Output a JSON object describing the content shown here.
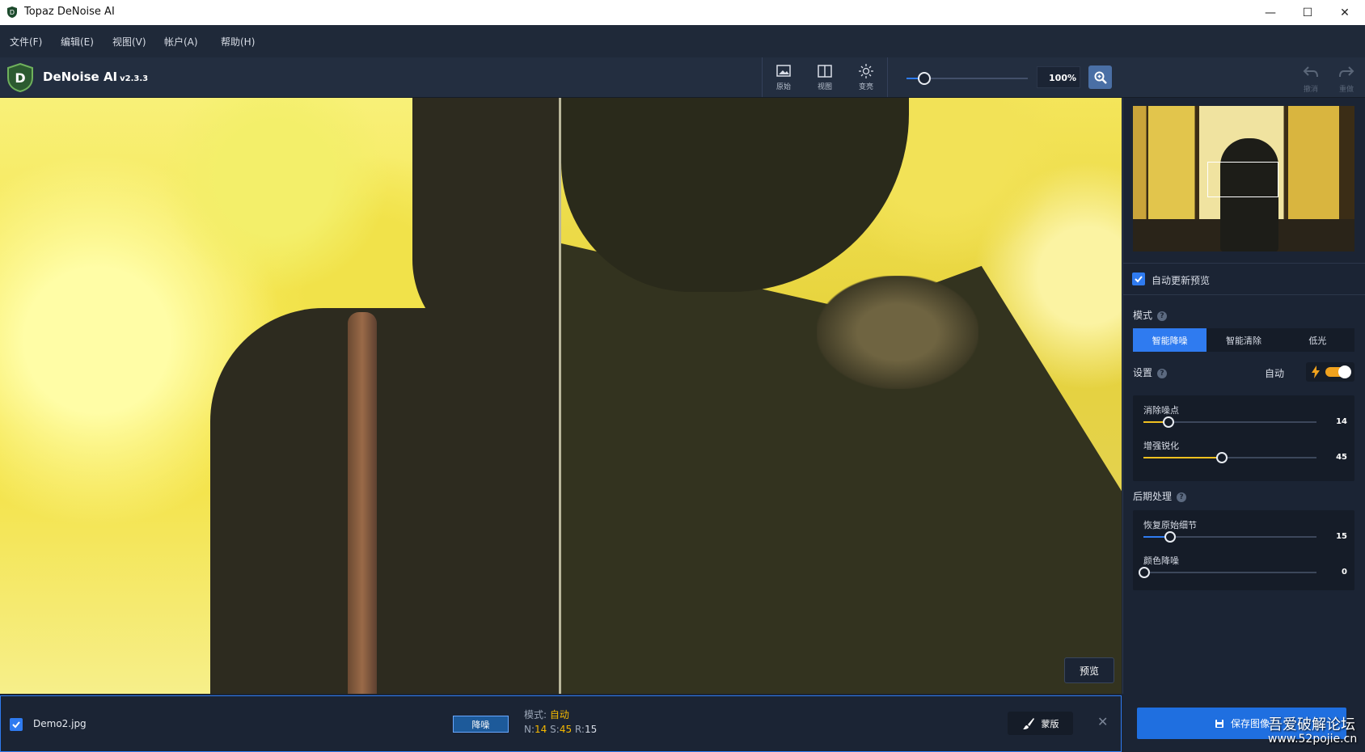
{
  "window": {
    "title": "Topaz DeNoise AI",
    "minimize": "—",
    "maximize": "☐",
    "close": "✕"
  },
  "menu": [
    "文件(F)",
    "编辑(E)",
    "视图(V)",
    "帐户(A)",
    "帮助(H)"
  ],
  "app": {
    "name": "DeNoise AI",
    "version": "v2.3.3"
  },
  "toolbar": {
    "original_label": "原始",
    "view_label": "视图",
    "brightness_label": "变亮",
    "zoom_value": "100%",
    "zoom_slider_fraction": 0.14,
    "undo_label": "撤消",
    "redo_label": "重做"
  },
  "canvas": {
    "preview_label": "预览"
  },
  "panel": {
    "auto_update_label": "自动更新预览",
    "auto_update_checked": true,
    "mode_title": "模式",
    "modes": [
      "智能降噪",
      "智能清除",
      "低光"
    ],
    "active_mode": 0,
    "settings_title": "设置",
    "auto_label": "自动",
    "auto_on": true,
    "sliders_settings": [
      {
        "label": "消除噪点",
        "value": "14",
        "fraction": 0.14
      },
      {
        "label": "增强锐化",
        "value": "45",
        "fraction": 0.45
      }
    ],
    "post_title": "后期处理",
    "sliders_post": [
      {
        "label": "恢复原始细节",
        "value": "15",
        "fraction": 0.15
      },
      {
        "label": "颜色降噪",
        "value": "0",
        "fraction": 0.0
      }
    ]
  },
  "bottom": {
    "file_checked": true,
    "file_name": "Demo2.jpg",
    "tag": "降噪",
    "mode_label": "模式:",
    "mode_value": "自动",
    "n_label": "N:",
    "n_value": "14",
    "s_label": "S:",
    "s_value": "45",
    "r_label": "R:",
    "r_value": "15",
    "mask_label": "蒙版",
    "close": "✕",
    "save_label": "保存图像"
  },
  "watermark": {
    "line1": "吾爱破解论坛",
    "line2": "www.52pojie.cn"
  },
  "colors": {
    "accent": "#2f7bf0",
    "highlight": "#f5b800",
    "background": "#1b2434"
  }
}
